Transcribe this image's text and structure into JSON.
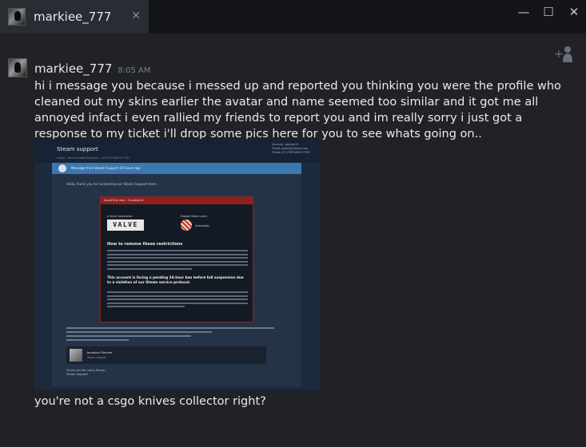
{
  "window": {
    "tab_title": "markiee_777",
    "tab_close_icon": "close-icon",
    "controls": {
      "minimize": "—",
      "maximize": "☐",
      "close": "✕"
    }
  },
  "chat": {
    "add_friend_icon": "add-user-icon",
    "message": {
      "sender": "markiee_777",
      "time": "8:05 AM",
      "text": "hi i message you because i messed up and reported you thinking you were the profile who cleaned out my skins earlier the avatar and name seemed too similar and it got me all annoyed infact i even rallied my friends to report you and im really sorry i just got a response to my ticket i'll drop some pics here for you to see whats going on..",
      "followup": "you're not a csgo knives collector right?"
    },
    "attachment": {
      "title": "Steam support",
      "account_lines": [
        "Account: gansky12",
        "Email: gsxky@yahoo.com",
        "Ticket: H7-2TEP-8003-7767"
      ],
      "breadcrumb": "Home › Recent Help Requests › H7-2TEP-8003-7767",
      "bar_text": "Message from Steam Support 24 hours ago",
      "greeting": "Hello, thank you for contacting our Steam Support team.",
      "notice_header": "Avoid this user - Fraudulent",
      "valve_label": "A Valve Corporation",
      "valve_logo": "VALVE",
      "engage_label": "Engage Steam users",
      "engage_name": "rhaindiskey",
      "restrictions_heading": "How to remove these restrictions",
      "warning": "This account is facing a pending 24-hour ban before full suspension due to a violation of our Steam service protocol.",
      "moderator_name": "Jonathan Fletcher",
      "moderator_role": "Steam support",
      "thanks": "Thank you for using Steam,",
      "signoff": "Steam Support"
    }
  }
}
